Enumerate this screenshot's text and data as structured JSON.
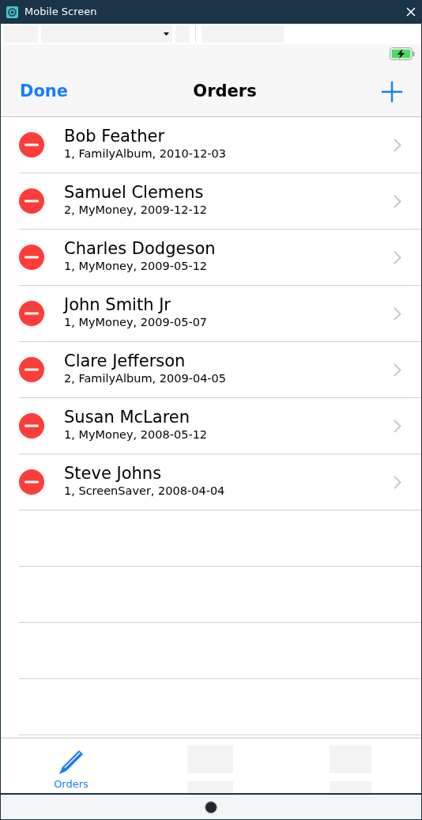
{
  "window": {
    "title": "Mobile Screen"
  },
  "nav_bar": {
    "left_button": "Done",
    "title": "Orders"
  },
  "orders": [
    {
      "name": "Bob Feather",
      "detail": "1, FamilyAlbum, 2010-12-03"
    },
    {
      "name": "Samuel Clemens",
      "detail": "2, MyMoney, 2009-12-12"
    },
    {
      "name": "Charles Dodgeson",
      "detail": "1, MyMoney, 2009-05-12"
    },
    {
      "name": "John Smith Jr",
      "detail": "1, MyMoney, 2009-05-07"
    },
    {
      "name": "Clare Jefferson",
      "detail": "2, FamilyAlbum, 2009-04-05"
    },
    {
      "name": "Susan McLaren",
      "detail": "1, MyMoney, 2008-05-12"
    },
    {
      "name": "Steve Johns",
      "detail": "1, ScreenSaver, 2008-04-04"
    }
  ],
  "tab_bar": [
    {
      "label": "Orders",
      "selected": true
    }
  ]
}
